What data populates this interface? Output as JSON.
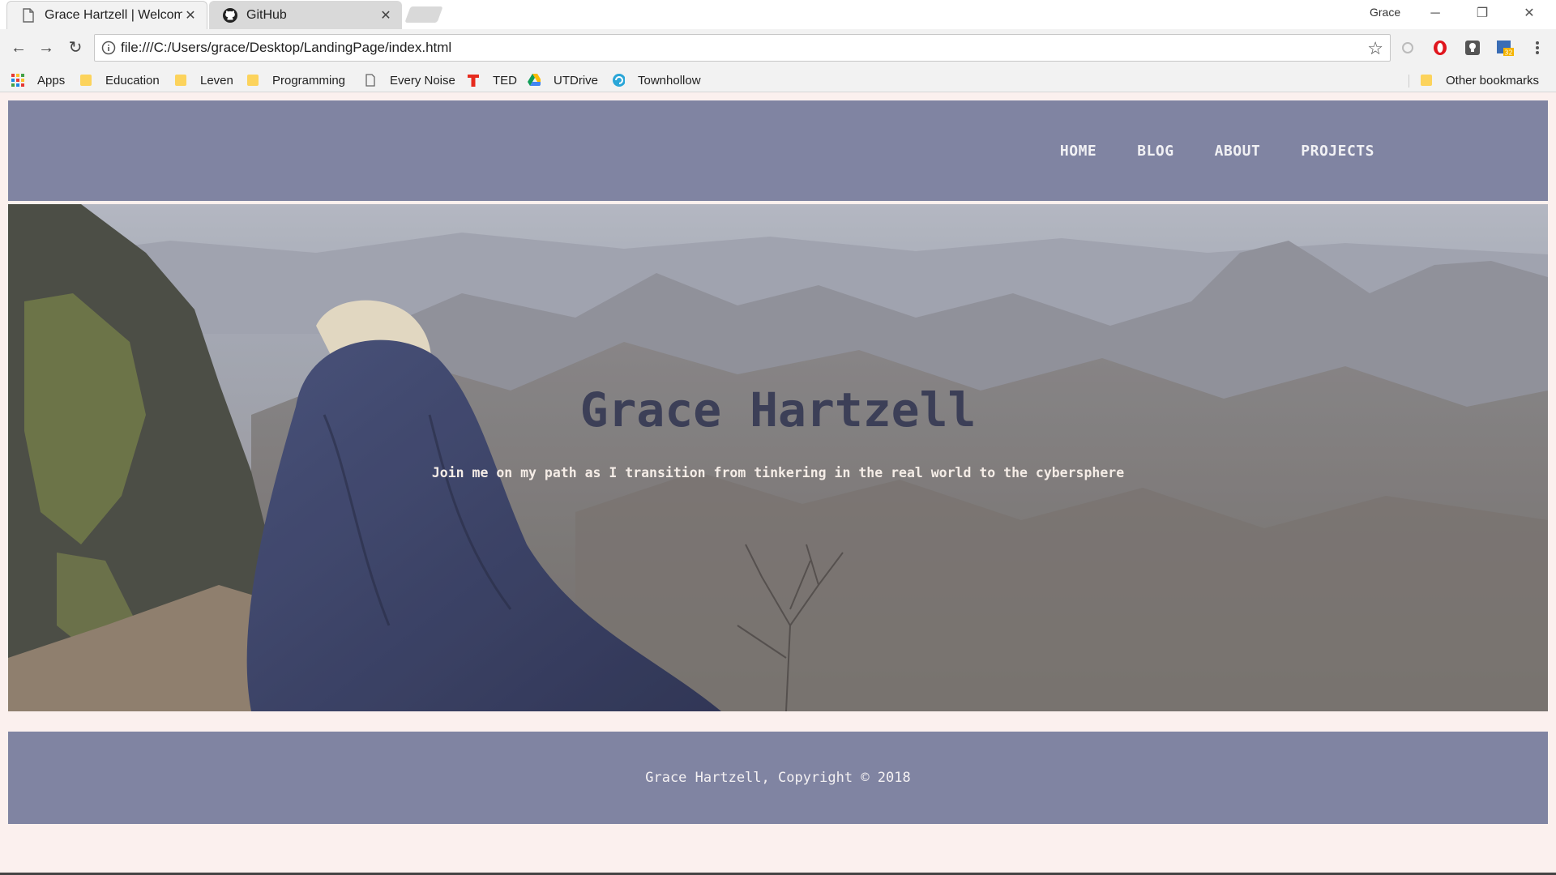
{
  "browser": {
    "tabs": [
      {
        "title": "Grace Hartzell | Welcome",
        "icon": "page-icon",
        "active": true
      },
      {
        "title": "GitHub",
        "icon": "github-icon",
        "active": false
      }
    ],
    "profile_name": "Grace",
    "address": "file:///C:/Users/grace/Desktop/LandingPage/index.html",
    "bookmarks": [
      {
        "label": "Apps",
        "icon": "apps-grid-icon"
      },
      {
        "label": "Education",
        "icon": "folder-icon"
      },
      {
        "label": "Leven",
        "icon": "folder-icon"
      },
      {
        "label": "Programming",
        "icon": "folder-icon"
      },
      {
        "label": "Every Noise",
        "icon": "page-icon"
      },
      {
        "label": "TED",
        "icon": "ted-icon"
      },
      {
        "label": "UTDrive",
        "icon": "drive-icon"
      },
      {
        "label": "Townhollow",
        "icon": "townhollow-icon"
      }
    ],
    "other_bookmarks": "Other bookmarks",
    "extension_badge": "32"
  },
  "page": {
    "nav": [
      "HOME",
      "BLOG",
      "ABOUT",
      "PROJECTS"
    ],
    "hero": {
      "title": "Grace Hartzell",
      "subtitle": "Join me on my path as I transition from tinkering in the real world to the cybersphere"
    },
    "footer": "Grace Hartzell, Copyright © 2018"
  },
  "colors": {
    "header_bg": "#8084a2",
    "page_bg": "#fbf0ee",
    "hero_title": "#3c3f57"
  }
}
